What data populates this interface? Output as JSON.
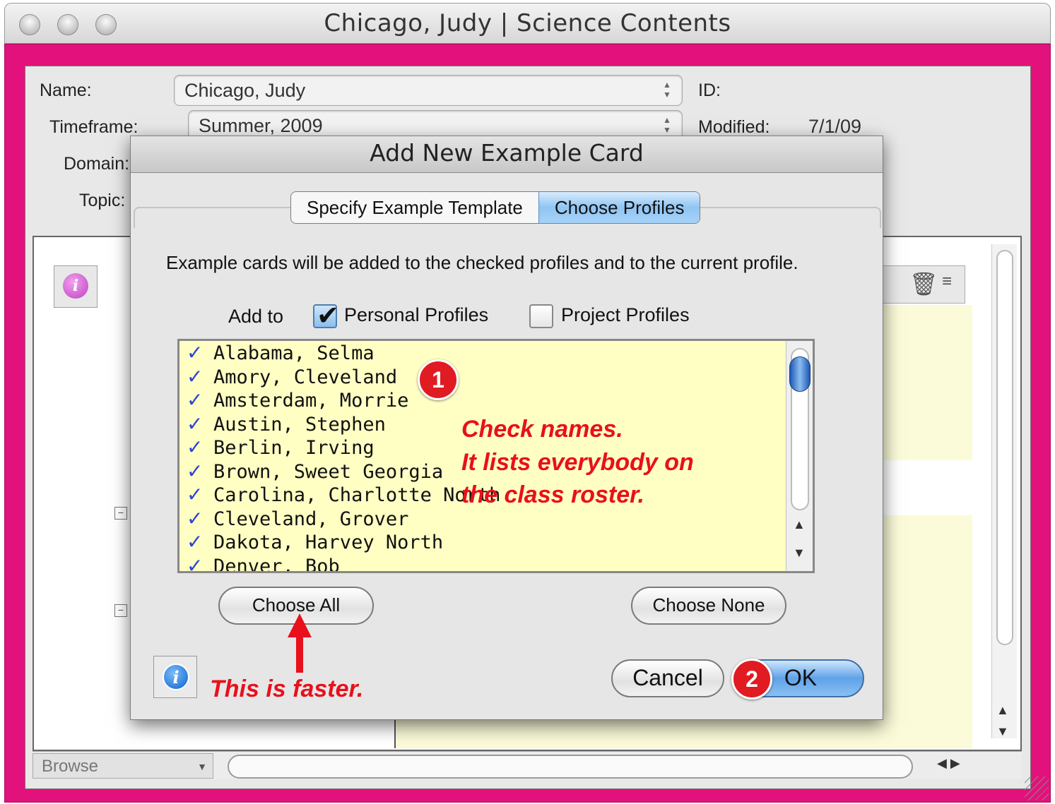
{
  "window": {
    "title": "Chicago, Judy | Science Contents"
  },
  "form": {
    "name_label": "Name:",
    "name_value": "Chicago, Judy",
    "timeframe_label": "Timeframe:",
    "timeframe_value": "Summer, 2009",
    "domain_label": "Domain:",
    "topic_label": "Topic:",
    "id_label": "ID:",
    "modified_label": "Modified:",
    "modified_value": "7/1/09"
  },
  "bottom": {
    "browse_label": "Browse"
  },
  "dialog": {
    "title": "Add New Example Card",
    "tabs": [
      {
        "label": "Specify Example Template"
      },
      {
        "label": "Choose Profiles"
      }
    ],
    "description": "Example cards will be added to the checked profiles and to the current profile.",
    "add_to_label": "Add to",
    "personal_profiles_label": "Personal Profiles",
    "personal_profiles_checked": true,
    "project_profiles_label": "Project Profiles",
    "project_profiles_checked": false,
    "profiles": [
      {
        "name": "Alabama, Selma",
        "checked": true
      },
      {
        "name": "Amory, Cleveland",
        "checked": true
      },
      {
        "name": "Amsterdam, Morrie",
        "checked": true
      },
      {
        "name": "Austin, Stephen",
        "checked": true
      },
      {
        "name": "Berlin, Irving",
        "checked": true
      },
      {
        "name": "Brown, Sweet Georgia",
        "checked": true
      },
      {
        "name": "Carolina, Charlotte North",
        "checked": true
      },
      {
        "name": "Cleveland, Grover",
        "checked": true
      },
      {
        "name": "Dakota, Harvey North",
        "checked": true
      },
      {
        "name": "Denver, Bob",
        "checked": true
      }
    ],
    "choose_all_label": "Choose All",
    "choose_none_label": "Choose None",
    "cancel_label": "Cancel",
    "ok_label": "OK"
  },
  "annotations": {
    "badge_1": "1",
    "badge_2": "2",
    "note_line_1": "Check names.",
    "note_line_2": "It lists everybody on",
    "note_line_3": "the class roster.",
    "faster_note": "This is faster.",
    "color": "#e8101c"
  },
  "colors": {
    "window_frame": "#e3117b",
    "list_background": "#ffffc4",
    "checkmark": "#2a44d8",
    "selected_tab": "#8fc5f3"
  }
}
